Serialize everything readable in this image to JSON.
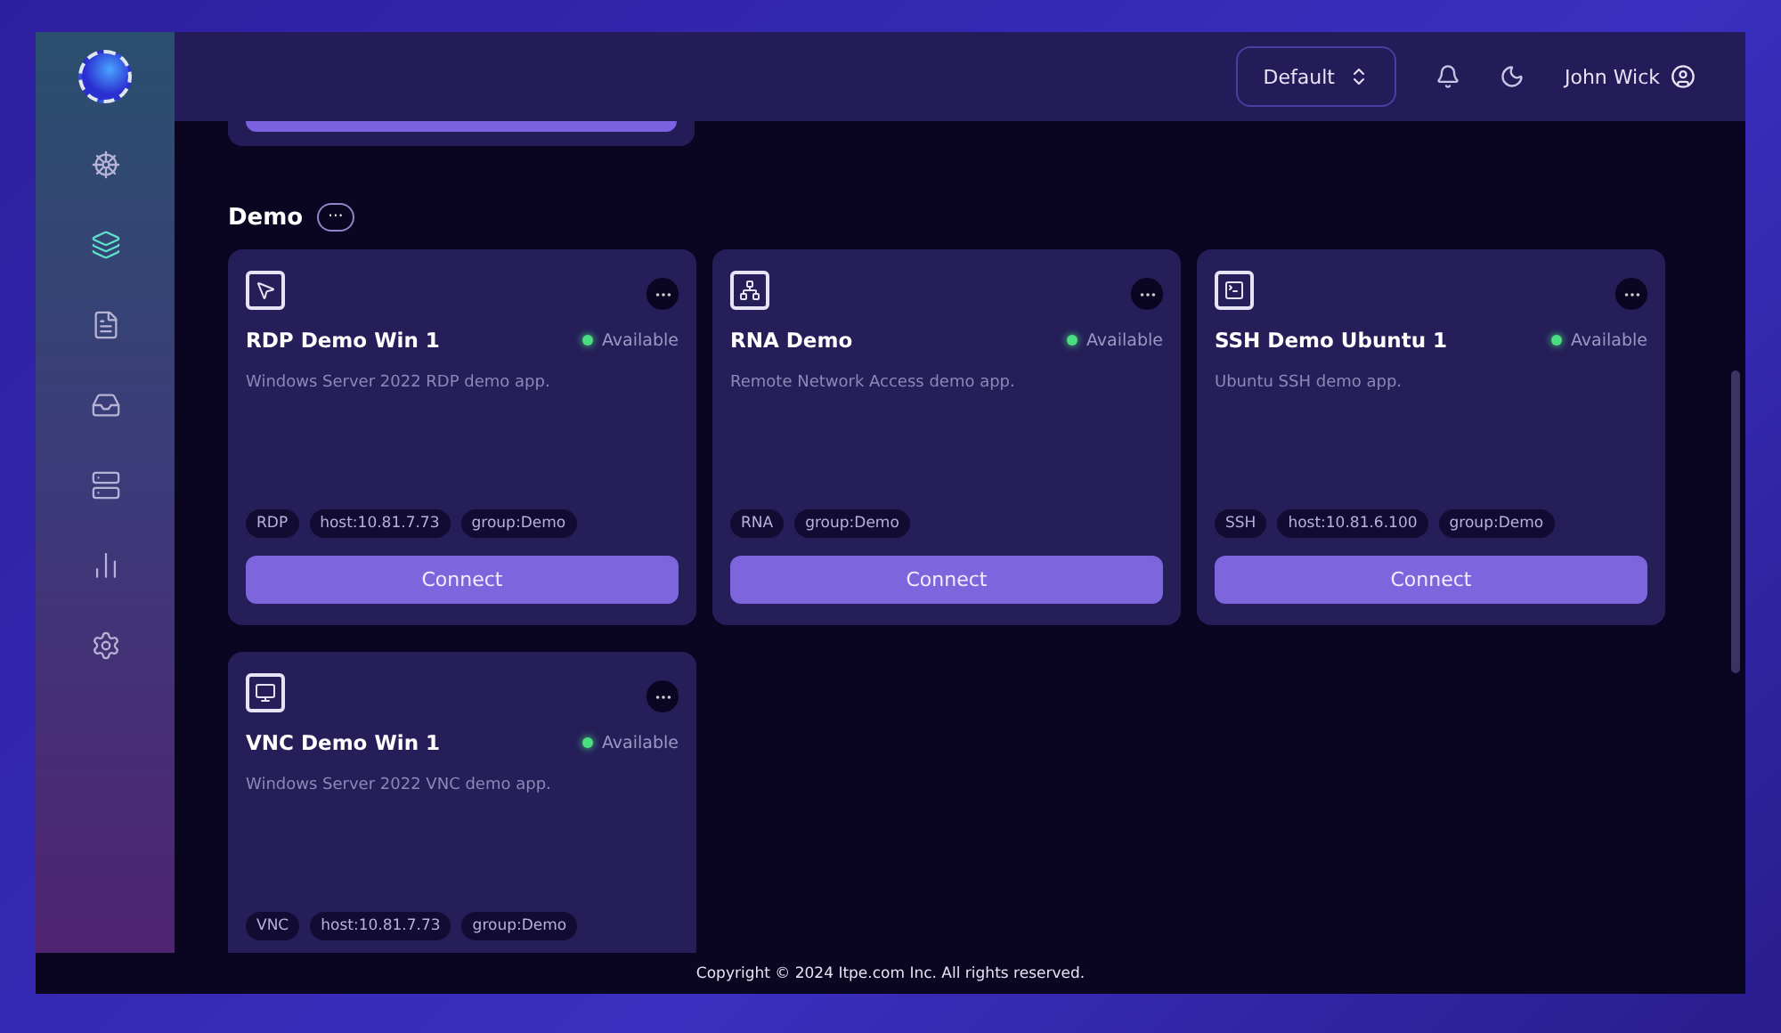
{
  "sidebar": {
    "items": [
      {
        "selected": false
      },
      {
        "selected": true
      },
      {
        "selected": false
      },
      {
        "selected": false
      },
      {
        "selected": false
      },
      {
        "selected": false
      },
      {
        "selected": false
      }
    ]
  },
  "header": {
    "environment": "Default",
    "user": "John Wick"
  },
  "section": {
    "title": "Demo",
    "more": "···"
  },
  "cards": [
    {
      "kind": "rdp",
      "title": "RDP Demo Win 1",
      "status": {
        "label": "Available",
        "color": "#4ade80"
      },
      "description": "Windows Server 2022 RDP demo app.",
      "tags": [
        "RDP",
        "host:10.81.7.73",
        "group:Demo"
      ],
      "action": "Connect"
    },
    {
      "kind": "rna",
      "title": "RNA Demo",
      "status": {
        "label": "Available",
        "color": "#4ade80"
      },
      "description": "Remote Network Access demo app.",
      "tags": [
        "RNA",
        "group:Demo"
      ],
      "action": "Connect"
    },
    {
      "kind": "ssh",
      "title": "SSH Demo Ubuntu 1",
      "status": {
        "label": "Available",
        "color": "#4ade80"
      },
      "description": "Ubuntu SSH demo app.",
      "tags": [
        "SSH",
        "host:10.81.6.100",
        "group:Demo"
      ],
      "action": "Connect"
    },
    {
      "kind": "vnc",
      "title": "VNC Demo Win 1",
      "status": {
        "label": "Available",
        "color": "#4ade80"
      },
      "description": "Windows Server 2022 VNC demo app.",
      "tags": [
        "VNC",
        "host:10.81.7.73",
        "group:Demo"
      ]
    }
  ],
  "footer": "Copyright © 2024 Itpe.com Inc. All rights reserved."
}
